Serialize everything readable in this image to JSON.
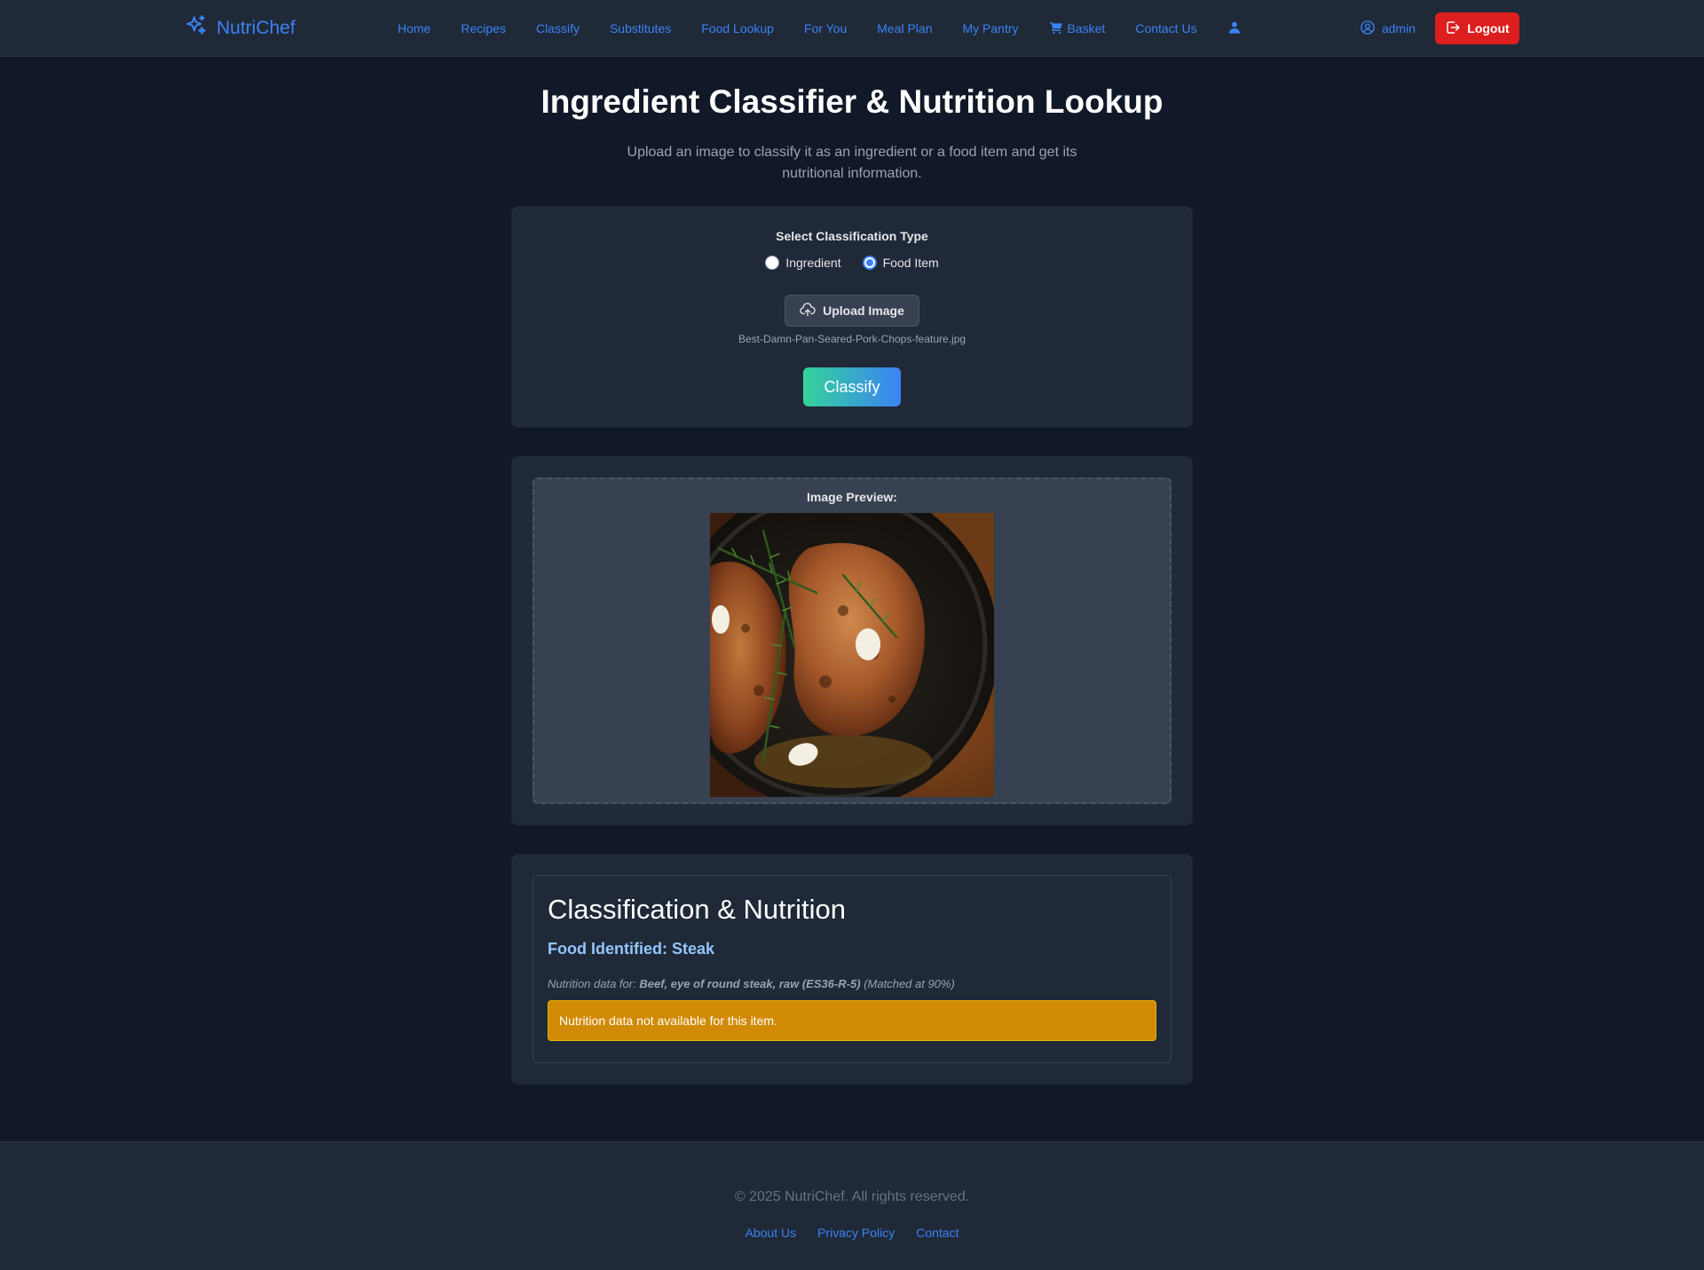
{
  "colors": {
    "background": "#111827",
    "surface": "#1f2937",
    "accent": "#3b82f6",
    "danger": "#dc1e1e",
    "warning": "#d18a04",
    "gradient_start": "#34d399",
    "gradient_end": "#3b82f6"
  },
  "nav": {
    "brand": "NutriChef",
    "brand_icon": "sparkles-icon",
    "links": [
      "Home",
      "Recipes",
      "Classify",
      "Substitutes",
      "Food Lookup",
      "For You",
      "Meal Plan",
      "My Pantry",
      "Basket",
      "Contact Us"
    ],
    "basket_icon": "cart-icon",
    "profile_icon": "user-icon",
    "user": "admin",
    "user_icon": "user-circle-icon",
    "logout": "Logout",
    "logout_icon": "logout-icon"
  },
  "header": {
    "title": "Ingredient Classifier & Nutrition Lookup",
    "subtitle": "Upload an image to classify it as an ingredient or a food item and get its nutritional information."
  },
  "classifier": {
    "type_label": "Select Classification Type",
    "options": [
      "Ingredient",
      "Food Item"
    ],
    "selected": "Food Item",
    "upload_label": "Upload Image",
    "upload_icon": "upload-cloud-icon",
    "file_name": "Best-Damn-Pan-Seared-Pork-Chops-feature.jpg",
    "classify_label": "Classify"
  },
  "preview": {
    "label": "Image Preview:"
  },
  "result": {
    "title": "Classification & Nutrition",
    "food_identified": "Food Identified: Steak",
    "nutrition_prefix": "Nutrition data for:",
    "nutrition_item": "Beef, eye of round steak, raw (ES36-R-5)",
    "match": "(Matched at 90%)",
    "alert": "Nutrition data not available for this item."
  },
  "footer": {
    "copyright": "© 2025 NutriChef. All rights reserved.",
    "links": [
      "About Us",
      "Privacy Policy",
      "Contact"
    ]
  }
}
